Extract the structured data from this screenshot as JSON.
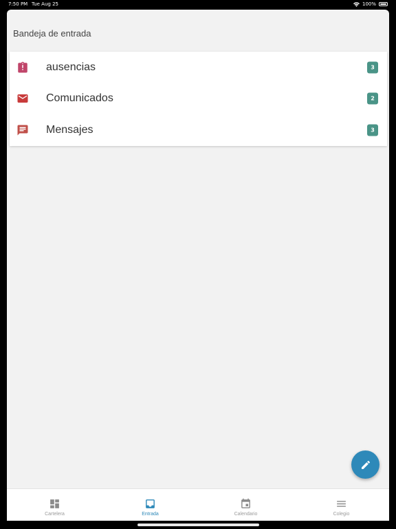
{
  "status_bar": {
    "time": "7:50 PM",
    "date": "Tue Aug 25",
    "battery": "100%",
    "icons": [
      "wifi-icon",
      "battery-icon"
    ]
  },
  "header": {
    "title": "Bandeja de entrada"
  },
  "inbox": {
    "items": [
      {
        "label": "ausencias",
        "count": "3",
        "icon": "clipboard-alert-icon",
        "icon_color": "#c0456a"
      },
      {
        "label": "Comunicados",
        "count": "2",
        "icon": "envelope-icon",
        "icon_color": "#c83b3b"
      },
      {
        "label": "Mensajes",
        "count": "3",
        "icon": "message-icon",
        "icon_color": "#c0504a"
      }
    ],
    "badge_color": "#4a9487"
  },
  "fab": {
    "icon": "pencil-icon",
    "color": "#2e89b9"
  },
  "tab_bar": {
    "tabs": [
      {
        "label": "Cartelera",
        "icon": "dashboard-icon",
        "active": false
      },
      {
        "label": "Entrada",
        "icon": "inbox-icon",
        "active": true
      },
      {
        "label": "Calendario",
        "icon": "calendar-icon",
        "active": false
      },
      {
        "label": "Colegio",
        "icon": "menu-icon",
        "active": false
      }
    ],
    "active_color": "#2e89b9",
    "inactive_color": "#9a9a9a"
  }
}
